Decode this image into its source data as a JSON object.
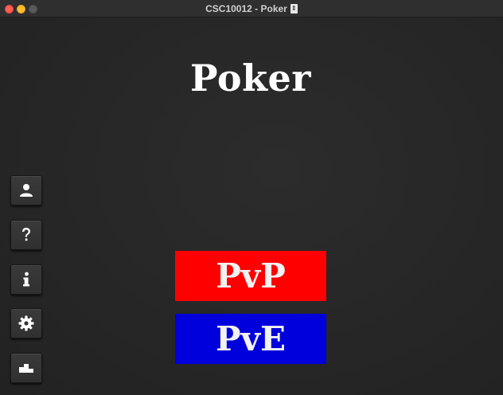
{
  "window": {
    "title": "CSC10012 - Poker",
    "title_icon": "document-proxy-icon"
  },
  "main": {
    "title": "Poker"
  },
  "sidebar": {
    "items": [
      {
        "name": "profile",
        "icon": "user-icon"
      },
      {
        "name": "help",
        "icon": "question-icon"
      },
      {
        "name": "info",
        "icon": "info-icon"
      },
      {
        "name": "settings",
        "icon": "gear-icon"
      },
      {
        "name": "leaderboard",
        "icon": "podium-icon"
      }
    ]
  },
  "modes": {
    "pvp_label": "PvP",
    "pve_label": "PvE",
    "pvp_color": "#ff0000",
    "pve_color": "#0000dd"
  }
}
